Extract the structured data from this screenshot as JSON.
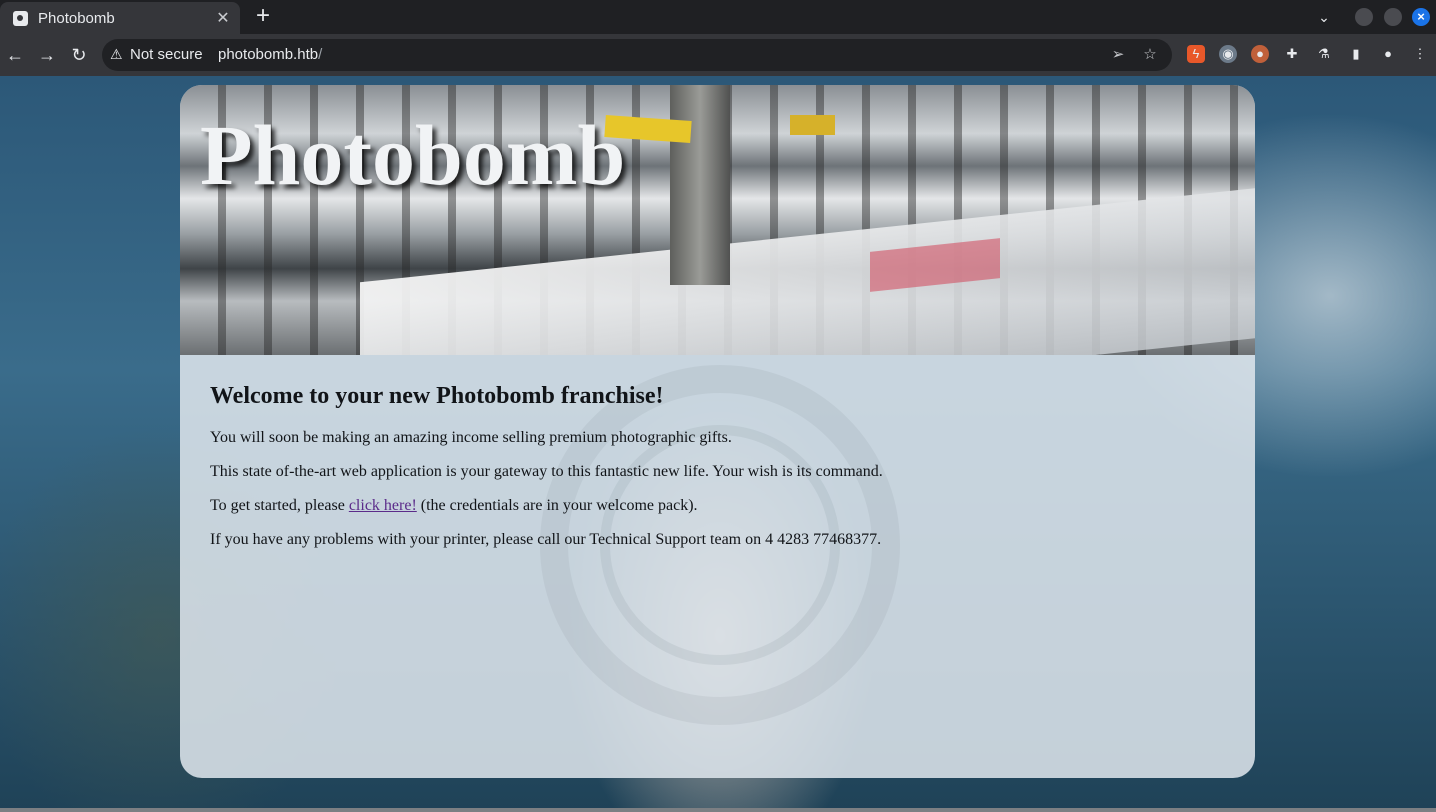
{
  "browser": {
    "tab_title": "Photobomb",
    "tab_close": "✕",
    "new_tab": "+",
    "security_label": "Not secure",
    "url_host": "photobomb.htb",
    "url_path": "/"
  },
  "page": {
    "hero_title": "Photobomb",
    "heading": "Welcome to your new Photobomb franchise!",
    "para1": "You will soon be making an amazing income selling premium photographic gifts.",
    "para2": "This state of-the-art web application is your gateway to this fantastic new life. Your wish is its command.",
    "para3_before": "To get started, please ",
    "para3_link": "click here!",
    "para3_after": " (the credentials are in your welcome pack).",
    "para4": "If you have any problems with your printer, please call our Technical Support team on 4 4283 77468377."
  },
  "icons": {
    "back": "back-arrow-icon",
    "forward": "forward-arrow-icon",
    "reload": "reload-icon",
    "warning": "warning-triangle-icon",
    "send": "send-icon",
    "star": "bookmark-star-icon",
    "extensions": "puzzle-icon",
    "profile": "profile-icon",
    "menu": "kebab-menu-icon"
  },
  "colors": {
    "link": "#5b2b8a",
    "accent": "#1a73e8"
  }
}
